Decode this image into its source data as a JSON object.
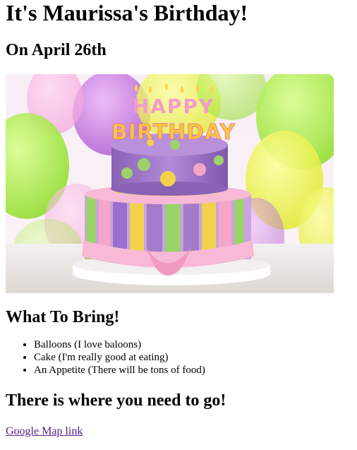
{
  "page": {
    "title": "It's Maurissa's Birthday!",
    "date_heading": "On April 26th",
    "hero_image": {
      "alt": "Birthday cake",
      "candle_letters_top": "HAPPY",
      "candle_letters_bottom": "BIRTHDAY",
      "colors": {
        "purple": "#a57ac8",
        "yellow": "#f2d24a",
        "green": "#9bd36a",
        "pink": "#f5a6c9",
        "balloon_yellow": "#e9ef3f",
        "balloon_green": "#a8ea3d",
        "balloon_purple": "#c06adb"
      }
    },
    "bring_heading": "What To Bring!",
    "bring_items": [
      "Balloons (I love baloons)",
      "Cake (I'm really good at eating)",
      "An Appetite (There will be tons of food)"
    ],
    "directions_heading": "There is where you need to go!",
    "map_link_text": "Google Map link"
  }
}
